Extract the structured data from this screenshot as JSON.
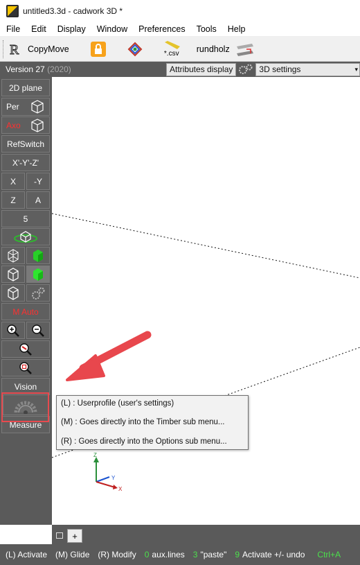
{
  "window": {
    "title": "untitled3.3d - cadwork 3D *"
  },
  "menu": [
    "File",
    "Edit",
    "Display",
    "Window",
    "Preferences",
    "Tools",
    "Help"
  ],
  "toolbar": {
    "copymove_label": "CopyMove",
    "csv_label": "*.csv",
    "rundholz_label": "rundholz"
  },
  "status": {
    "version": "Version 27",
    "version_year": "(2020)",
    "attributes_tab": "Attributes display",
    "settings_select": "3D settings"
  },
  "left_panel": {
    "plane2d": "2D plane",
    "per": "Per",
    "axo": "Axo",
    "refswitch": "RefSwitch",
    "xyz": "X'-Y'-Z'",
    "x": "X",
    "neg_y": "-Y",
    "z": "Z",
    "a": "A",
    "five": "5",
    "m_auto": "M Auto",
    "vision": "Vision",
    "measure": "Measure"
  },
  "tooltip": {
    "lines": [
      "(L) : Userprofile  (user's settings)",
      "(M) : Goes directly into the Timber sub menu...",
      "(R) : Goes directly into the Options sub menu..."
    ]
  },
  "axes": {
    "z": "Z",
    "y": "Y",
    "x": "X"
  },
  "tabs": {
    "add": "+"
  },
  "bottom": {
    "l_activate": "(L) Activate",
    "m_glide": "(M) Glide",
    "r_modify": "(R) Modify",
    "auxlines_num": "0",
    "auxlines_text": "aux.lines",
    "paste_num": "3",
    "paste_text": "\"paste\"",
    "activate_num": "9",
    "activate_text": "Activate +/- undo",
    "ctrl": "Ctrl+A"
  },
  "colors": {
    "panel": "#5a5a5a",
    "highlight": "#e84a4f",
    "green": "#4cdf4c"
  }
}
